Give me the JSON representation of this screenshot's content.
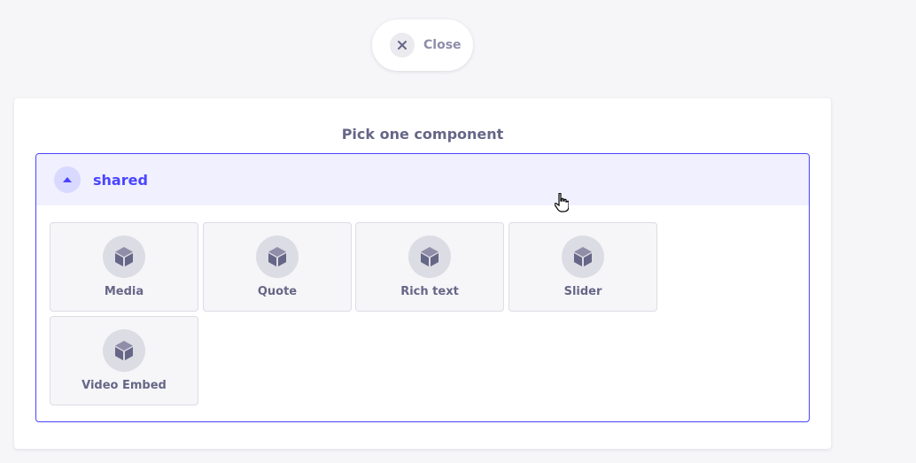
{
  "close_button": {
    "label": "Close",
    "icon": "close-icon"
  },
  "panel": {
    "title": "Pick one component",
    "category": {
      "name": "shared",
      "expanded": true,
      "toggle_icon": "chevron-up-icon"
    },
    "components": [
      {
        "label": "Media",
        "icon": "cube-icon"
      },
      {
        "label": "Quote",
        "icon": "cube-icon"
      },
      {
        "label": "Rich text",
        "icon": "cube-icon"
      },
      {
        "label": "Slider",
        "icon": "cube-icon"
      },
      {
        "label": "Video Embed",
        "icon": "cube-icon"
      }
    ]
  },
  "colors": {
    "accent": "#4945ff",
    "accent_bg": "#f0f0ff",
    "neutral_text": "#666687",
    "card_bg": "#f6f6f9"
  }
}
